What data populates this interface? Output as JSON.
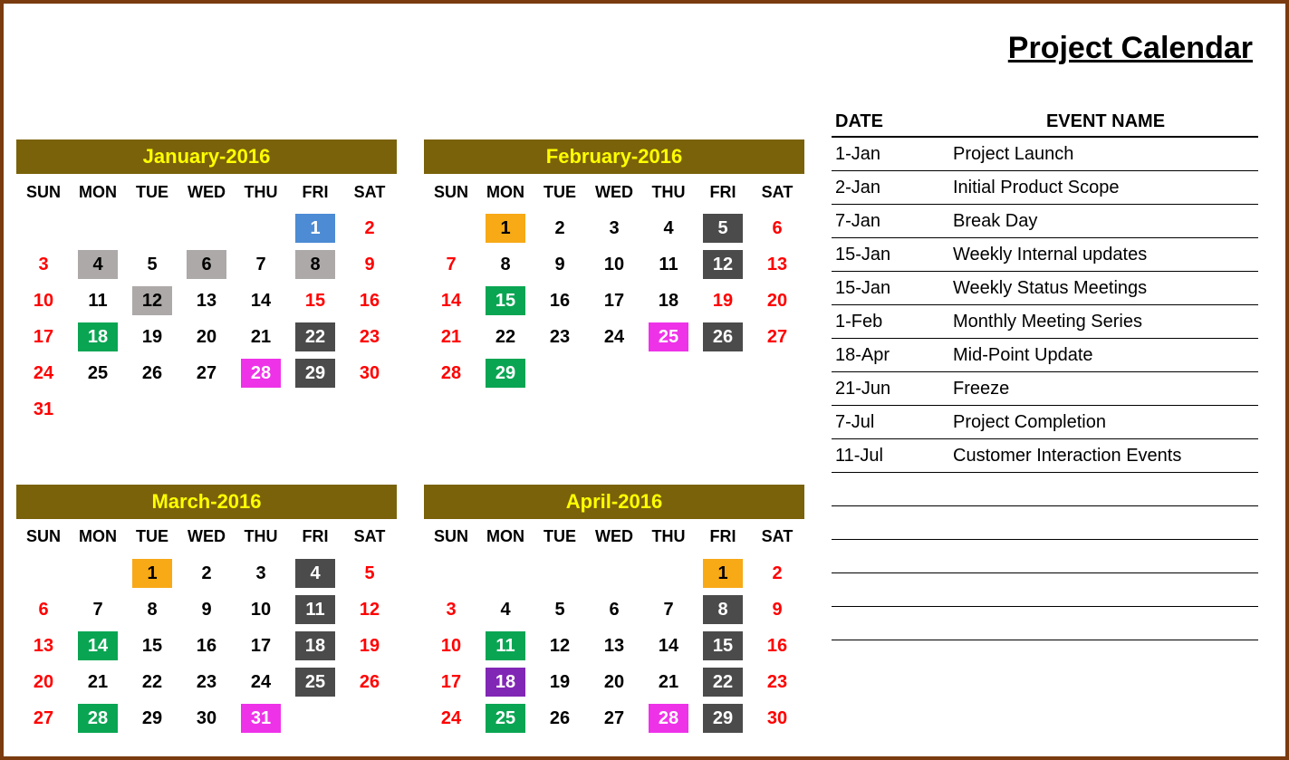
{
  "title": "Project Calendar",
  "dow": [
    "SUN",
    "MON",
    "TUE",
    "WED",
    "THU",
    "FRI",
    "SAT"
  ],
  "event_table": {
    "headers": {
      "date": "DATE",
      "name": "EVENT NAME"
    },
    "rows": [
      {
        "date": "1-Jan",
        "name": "Project Launch"
      },
      {
        "date": "2-Jan",
        "name": "Initial Product Scope"
      },
      {
        "date": "7-Jan",
        "name": "Break Day"
      },
      {
        "date": "15-Jan",
        "name": "Weekly Internal updates"
      },
      {
        "date": "15-Jan",
        "name": "Weekly Status Meetings"
      },
      {
        "date": "1-Feb",
        "name": "Monthly Meeting Series"
      },
      {
        "date": "18-Apr",
        "name": "Mid-Point Update"
      },
      {
        "date": "21-Jun",
        "name": "Freeze"
      },
      {
        "date": "7-Jul",
        "name": "Project Completion"
      },
      {
        "date": "11-Jul",
        "name": "Customer Interaction Events"
      }
    ],
    "blank_rows": 5
  },
  "months": [
    {
      "title": "January-2016",
      "weeks": [
        [
          null,
          null,
          null,
          null,
          null,
          {
            "n": "1",
            "bg": "blue"
          },
          {
            "n": "2",
            "weekend": true
          }
        ],
        [
          {
            "n": "3",
            "weekend": true
          },
          {
            "n": "4",
            "bg": "gray"
          },
          {
            "n": "5"
          },
          {
            "n": "6",
            "bg": "gray"
          },
          {
            "n": "7"
          },
          {
            "n": "8",
            "bg": "gray"
          },
          {
            "n": "9",
            "weekend": true
          }
        ],
        [
          {
            "n": "10",
            "weekend": true
          },
          {
            "n": "11"
          },
          {
            "n": "12",
            "bg": "gray"
          },
          {
            "n": "13"
          },
          {
            "n": "14"
          },
          {
            "n": "15",
            "weekend": true
          },
          {
            "n": "16",
            "weekend": true
          }
        ],
        [
          {
            "n": "17",
            "weekend": true
          },
          {
            "n": "18",
            "bg": "green"
          },
          {
            "n": "19"
          },
          {
            "n": "20"
          },
          {
            "n": "21"
          },
          {
            "n": "22",
            "bg": "darkgray"
          },
          {
            "n": "23",
            "weekend": true
          }
        ],
        [
          {
            "n": "24",
            "weekend": true
          },
          {
            "n": "25"
          },
          {
            "n": "26"
          },
          {
            "n": "27"
          },
          {
            "n": "28",
            "bg": "magenta"
          },
          {
            "n": "29",
            "bg": "darkgray"
          },
          {
            "n": "30",
            "weekend": true
          }
        ],
        [
          {
            "n": "31",
            "weekend": true
          },
          null,
          null,
          null,
          null,
          null,
          null
        ]
      ]
    },
    {
      "title": "February-2016",
      "weeks": [
        [
          null,
          {
            "n": "1",
            "bg": "orange"
          },
          {
            "n": "2"
          },
          {
            "n": "3"
          },
          {
            "n": "4"
          },
          {
            "n": "5",
            "bg": "darkgray"
          },
          {
            "n": "6",
            "weekend": true
          }
        ],
        [
          {
            "n": "7",
            "weekend": true
          },
          {
            "n": "8"
          },
          {
            "n": "9"
          },
          {
            "n": "10"
          },
          {
            "n": "11"
          },
          {
            "n": "12",
            "bg": "darkgray"
          },
          {
            "n": "13",
            "weekend": true
          }
        ],
        [
          {
            "n": "14",
            "weekend": true
          },
          {
            "n": "15",
            "bg": "green"
          },
          {
            "n": "16"
          },
          {
            "n": "17"
          },
          {
            "n": "18"
          },
          {
            "n": "19",
            "weekend": true
          },
          {
            "n": "20",
            "weekend": true
          }
        ],
        [
          {
            "n": "21",
            "weekend": true
          },
          {
            "n": "22"
          },
          {
            "n": "23"
          },
          {
            "n": "24"
          },
          {
            "n": "25",
            "bg": "magenta"
          },
          {
            "n": "26",
            "bg": "darkgray"
          },
          {
            "n": "27",
            "weekend": true
          }
        ],
        [
          {
            "n": "28",
            "weekend": true
          },
          {
            "n": "29",
            "bg": "green"
          },
          null,
          null,
          null,
          null,
          null
        ]
      ]
    },
    {
      "title": "March-2016",
      "weeks": [
        [
          null,
          null,
          {
            "n": "1",
            "bg": "orange"
          },
          {
            "n": "2"
          },
          {
            "n": "3"
          },
          {
            "n": "4",
            "bg": "darkgray"
          },
          {
            "n": "5",
            "weekend": true
          }
        ],
        [
          {
            "n": "6",
            "weekend": true
          },
          {
            "n": "7"
          },
          {
            "n": "8"
          },
          {
            "n": "9"
          },
          {
            "n": "10"
          },
          {
            "n": "11",
            "bg": "darkgray"
          },
          {
            "n": "12",
            "weekend": true
          }
        ],
        [
          {
            "n": "13",
            "weekend": true
          },
          {
            "n": "14",
            "bg": "green"
          },
          {
            "n": "15"
          },
          {
            "n": "16"
          },
          {
            "n": "17"
          },
          {
            "n": "18",
            "bg": "darkgray"
          },
          {
            "n": "19",
            "weekend": true
          }
        ],
        [
          {
            "n": "20",
            "weekend": true
          },
          {
            "n": "21"
          },
          {
            "n": "22"
          },
          {
            "n": "23"
          },
          {
            "n": "24"
          },
          {
            "n": "25",
            "bg": "darkgray"
          },
          {
            "n": "26",
            "weekend": true
          }
        ],
        [
          {
            "n": "27",
            "weekend": true
          },
          {
            "n": "28",
            "bg": "green"
          },
          {
            "n": "29"
          },
          {
            "n": "30"
          },
          {
            "n": "31",
            "bg": "magenta"
          },
          null,
          null
        ]
      ]
    },
    {
      "title": "April-2016",
      "weeks": [
        [
          null,
          null,
          null,
          null,
          null,
          {
            "n": "1",
            "bg": "orange"
          },
          {
            "n": "2",
            "weekend": true
          }
        ],
        [
          {
            "n": "3",
            "weekend": true
          },
          {
            "n": "4"
          },
          {
            "n": "5"
          },
          {
            "n": "6"
          },
          {
            "n": "7"
          },
          {
            "n": "8",
            "bg": "darkgray"
          },
          {
            "n": "9",
            "weekend": true
          }
        ],
        [
          {
            "n": "10",
            "weekend": true
          },
          {
            "n": "11",
            "bg": "green"
          },
          {
            "n": "12"
          },
          {
            "n": "13"
          },
          {
            "n": "14"
          },
          {
            "n": "15",
            "bg": "darkgray"
          },
          {
            "n": "16",
            "weekend": true
          }
        ],
        [
          {
            "n": "17",
            "weekend": true
          },
          {
            "n": "18",
            "bg": "purple"
          },
          {
            "n": "19"
          },
          {
            "n": "20"
          },
          {
            "n": "21"
          },
          {
            "n": "22",
            "bg": "darkgray"
          },
          {
            "n": "23",
            "weekend": true
          }
        ],
        [
          {
            "n": "24",
            "weekend": true
          },
          {
            "n": "25",
            "bg": "green"
          },
          {
            "n": "26"
          },
          {
            "n": "27"
          },
          {
            "n": "28",
            "bg": "magenta"
          },
          {
            "n": "29",
            "bg": "darkgray"
          },
          {
            "n": "30",
            "weekend": true
          }
        ]
      ]
    }
  ]
}
